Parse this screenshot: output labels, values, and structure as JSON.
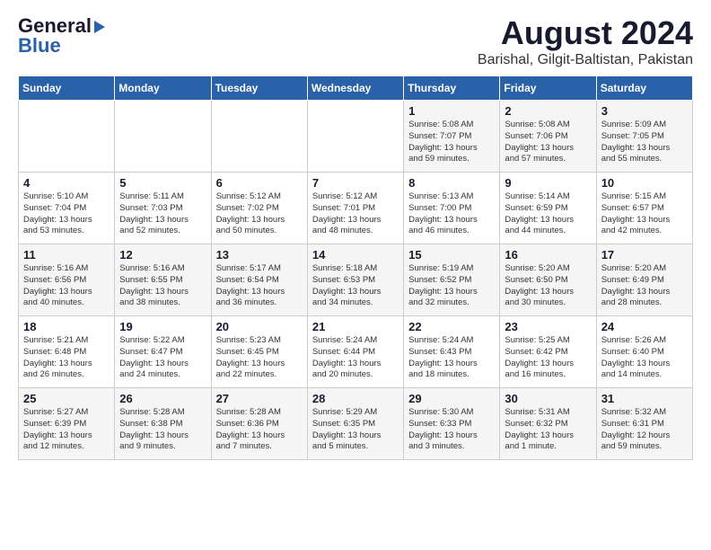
{
  "logo": {
    "line1": "General",
    "line2": "Blue"
  },
  "header": {
    "month_year": "August 2024",
    "location": "Barishal, Gilgit-Baltistan, Pakistan"
  },
  "days_of_week": [
    "Sunday",
    "Monday",
    "Tuesday",
    "Wednesday",
    "Thursday",
    "Friday",
    "Saturday"
  ],
  "weeks": [
    [
      {
        "day": "",
        "info": ""
      },
      {
        "day": "",
        "info": ""
      },
      {
        "day": "",
        "info": ""
      },
      {
        "day": "",
        "info": ""
      },
      {
        "day": "1",
        "info": "Sunrise: 5:08 AM\nSunset: 7:07 PM\nDaylight: 13 hours\nand 59 minutes."
      },
      {
        "day": "2",
        "info": "Sunrise: 5:08 AM\nSunset: 7:06 PM\nDaylight: 13 hours\nand 57 minutes."
      },
      {
        "day": "3",
        "info": "Sunrise: 5:09 AM\nSunset: 7:05 PM\nDaylight: 13 hours\nand 55 minutes."
      }
    ],
    [
      {
        "day": "4",
        "info": "Sunrise: 5:10 AM\nSunset: 7:04 PM\nDaylight: 13 hours\nand 53 minutes."
      },
      {
        "day": "5",
        "info": "Sunrise: 5:11 AM\nSunset: 7:03 PM\nDaylight: 13 hours\nand 52 minutes."
      },
      {
        "day": "6",
        "info": "Sunrise: 5:12 AM\nSunset: 7:02 PM\nDaylight: 13 hours\nand 50 minutes."
      },
      {
        "day": "7",
        "info": "Sunrise: 5:12 AM\nSunset: 7:01 PM\nDaylight: 13 hours\nand 48 minutes."
      },
      {
        "day": "8",
        "info": "Sunrise: 5:13 AM\nSunset: 7:00 PM\nDaylight: 13 hours\nand 46 minutes."
      },
      {
        "day": "9",
        "info": "Sunrise: 5:14 AM\nSunset: 6:59 PM\nDaylight: 13 hours\nand 44 minutes."
      },
      {
        "day": "10",
        "info": "Sunrise: 5:15 AM\nSunset: 6:57 PM\nDaylight: 13 hours\nand 42 minutes."
      }
    ],
    [
      {
        "day": "11",
        "info": "Sunrise: 5:16 AM\nSunset: 6:56 PM\nDaylight: 13 hours\nand 40 minutes."
      },
      {
        "day": "12",
        "info": "Sunrise: 5:16 AM\nSunset: 6:55 PM\nDaylight: 13 hours\nand 38 minutes."
      },
      {
        "day": "13",
        "info": "Sunrise: 5:17 AM\nSunset: 6:54 PM\nDaylight: 13 hours\nand 36 minutes."
      },
      {
        "day": "14",
        "info": "Sunrise: 5:18 AM\nSunset: 6:53 PM\nDaylight: 13 hours\nand 34 minutes."
      },
      {
        "day": "15",
        "info": "Sunrise: 5:19 AM\nSunset: 6:52 PM\nDaylight: 13 hours\nand 32 minutes."
      },
      {
        "day": "16",
        "info": "Sunrise: 5:20 AM\nSunset: 6:50 PM\nDaylight: 13 hours\nand 30 minutes."
      },
      {
        "day": "17",
        "info": "Sunrise: 5:20 AM\nSunset: 6:49 PM\nDaylight: 13 hours\nand 28 minutes."
      }
    ],
    [
      {
        "day": "18",
        "info": "Sunrise: 5:21 AM\nSunset: 6:48 PM\nDaylight: 13 hours\nand 26 minutes."
      },
      {
        "day": "19",
        "info": "Sunrise: 5:22 AM\nSunset: 6:47 PM\nDaylight: 13 hours\nand 24 minutes."
      },
      {
        "day": "20",
        "info": "Sunrise: 5:23 AM\nSunset: 6:45 PM\nDaylight: 13 hours\nand 22 minutes."
      },
      {
        "day": "21",
        "info": "Sunrise: 5:24 AM\nSunset: 6:44 PM\nDaylight: 13 hours\nand 20 minutes."
      },
      {
        "day": "22",
        "info": "Sunrise: 5:24 AM\nSunset: 6:43 PM\nDaylight: 13 hours\nand 18 minutes."
      },
      {
        "day": "23",
        "info": "Sunrise: 5:25 AM\nSunset: 6:42 PM\nDaylight: 13 hours\nand 16 minutes."
      },
      {
        "day": "24",
        "info": "Sunrise: 5:26 AM\nSunset: 6:40 PM\nDaylight: 13 hours\nand 14 minutes."
      }
    ],
    [
      {
        "day": "25",
        "info": "Sunrise: 5:27 AM\nSunset: 6:39 PM\nDaylight: 13 hours\nand 12 minutes."
      },
      {
        "day": "26",
        "info": "Sunrise: 5:28 AM\nSunset: 6:38 PM\nDaylight: 13 hours\nand 9 minutes."
      },
      {
        "day": "27",
        "info": "Sunrise: 5:28 AM\nSunset: 6:36 PM\nDaylight: 13 hours\nand 7 minutes."
      },
      {
        "day": "28",
        "info": "Sunrise: 5:29 AM\nSunset: 6:35 PM\nDaylight: 13 hours\nand 5 minutes."
      },
      {
        "day": "29",
        "info": "Sunrise: 5:30 AM\nSunset: 6:33 PM\nDaylight: 13 hours\nand 3 minutes."
      },
      {
        "day": "30",
        "info": "Sunrise: 5:31 AM\nSunset: 6:32 PM\nDaylight: 13 hours\nand 1 minute."
      },
      {
        "day": "31",
        "info": "Sunrise: 5:32 AM\nSunset: 6:31 PM\nDaylight: 12 hours\nand 59 minutes."
      }
    ]
  ]
}
